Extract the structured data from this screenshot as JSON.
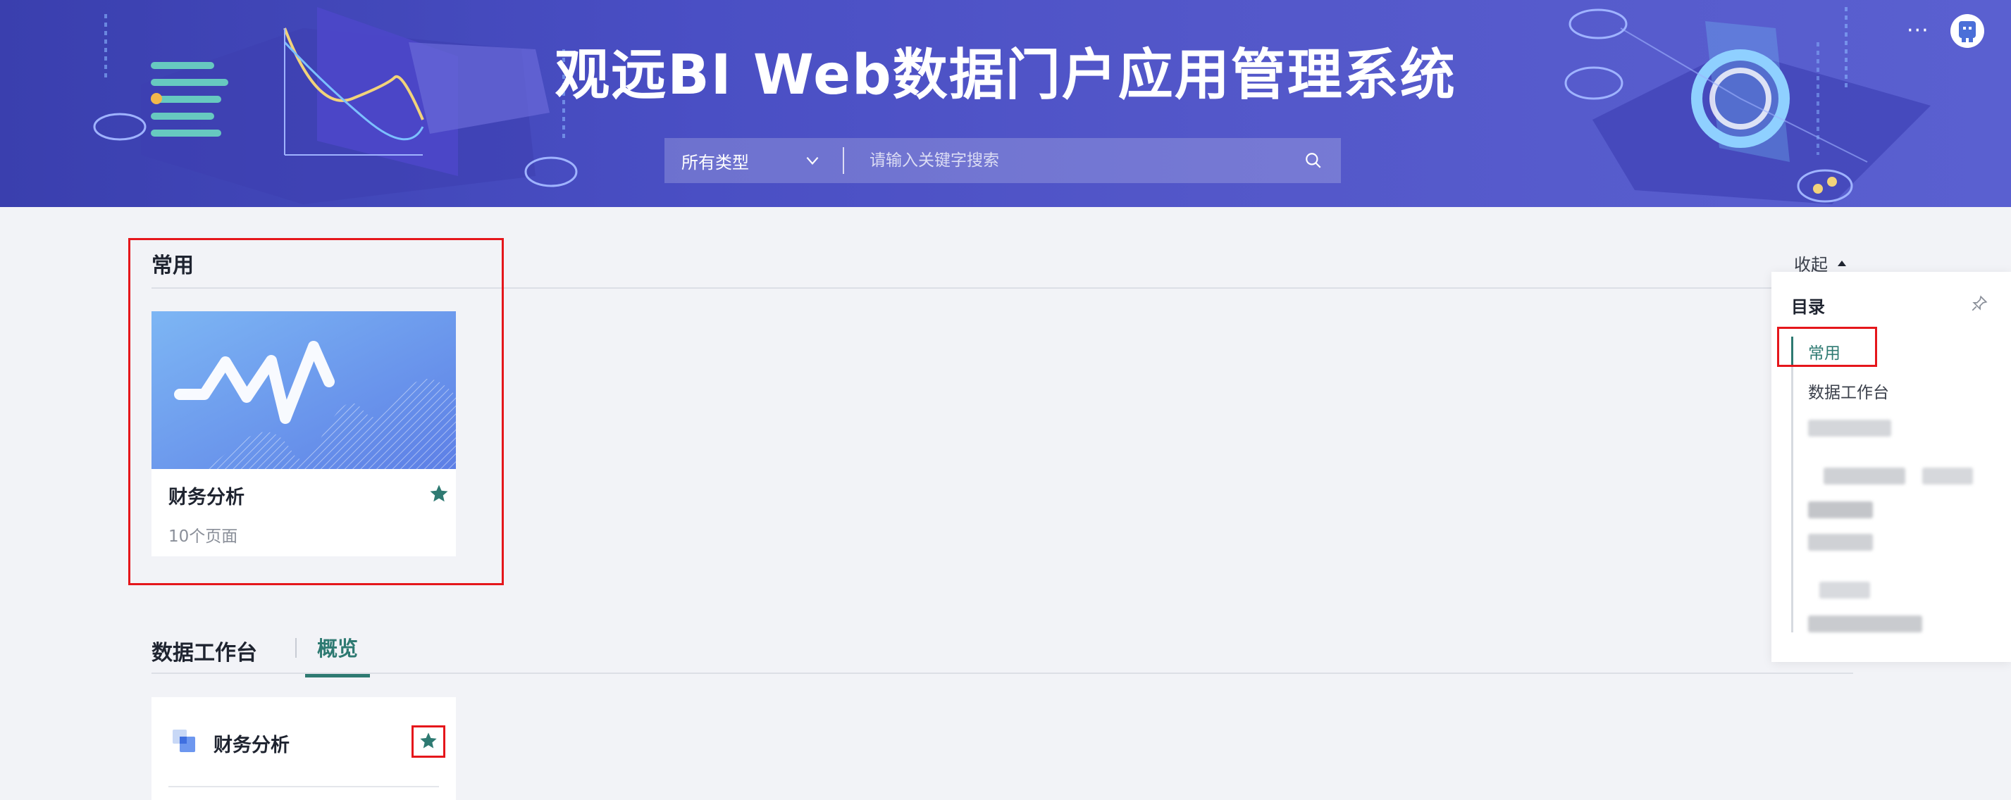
{
  "header": {
    "title": "观远BI Web数据门户应用管理系统",
    "more_icon": "more-icon",
    "avatar_icon": "user-avatar-icon",
    "search": {
      "type_selected": "所有类型",
      "placeholder": "请输入关键字搜索",
      "search_icon": "search-icon"
    }
  },
  "favorites": {
    "title": "常用",
    "card": {
      "title": "财务分析",
      "subtitle": "10个页面",
      "starred": true
    }
  },
  "workbench": {
    "title": "数据工作台",
    "tabs": [
      {
        "label": "概览",
        "active": true
      }
    ],
    "card": {
      "title": "财务分析",
      "starred": true
    }
  },
  "toc": {
    "collapse_label": "收起",
    "title": "目录",
    "items": [
      {
        "label": "常用",
        "active": true
      },
      {
        "label": "数据工作台",
        "active": false
      }
    ]
  },
  "colors": {
    "accent": "#2e7a72",
    "highlight_box": "#e5161b",
    "banner": "#4a4fc4"
  }
}
